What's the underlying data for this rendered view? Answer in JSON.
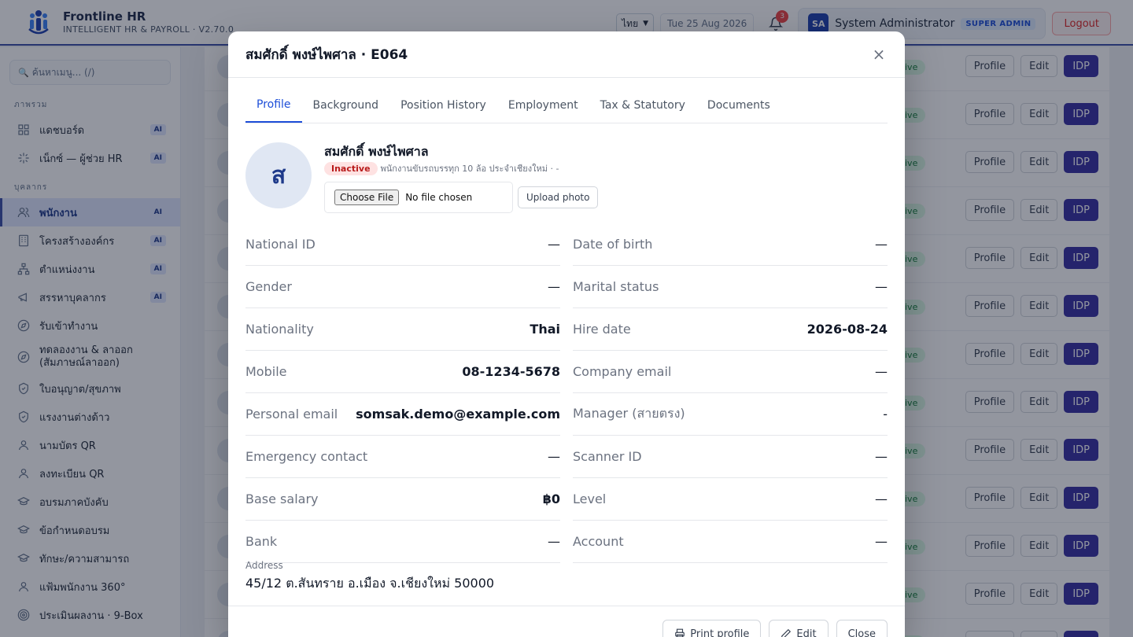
{
  "app": {
    "name": "Frontline HR",
    "subtitle": "INTELLIGENT HR & PAYROLL · V2.70.0",
    "language": "ไทย",
    "date": "Tue 25 Aug 2026",
    "notification_count": "3",
    "user_initials": "SA",
    "user_name": "System Administrator",
    "role": "SUPER ADMIN",
    "logout_label": "Logout",
    "accent_color": "#3b4fa8"
  },
  "sidebar": {
    "search_placeholder": "ค้นหาเมนู... (/)",
    "section_overview": "ภาพรวม",
    "overview_items": [
      {
        "label": "แดชบอร์ด",
        "badge": "AI",
        "icon": "grid-icon"
      },
      {
        "label": "เน็กซ์ — ผู้ช่วย HR",
        "badge": "AI",
        "icon": "sparkle-icon"
      }
    ],
    "section_people": "บุคลากร",
    "people_items": [
      {
        "label": "พนักงาน",
        "badge": "AI",
        "icon": "users-icon",
        "active": true
      },
      {
        "label": "โครงสร้างองค์กร",
        "badge": "AI",
        "icon": "building-icon"
      },
      {
        "label": "ตำแหน่งงาน",
        "badge": "AI",
        "icon": "org-chart-icon"
      },
      {
        "label": "สรรหาบุคลากร",
        "badge": "AI",
        "icon": "megaphone-icon"
      },
      {
        "label": "รับเข้าทำงาน",
        "badge": "",
        "icon": "compass-icon"
      },
      {
        "label": "ทดลองงาน & ลาออก (สัมภาษณ์ลาออก)",
        "badge": "",
        "icon": "compass-icon"
      },
      {
        "label": "ใบอนุญาต/สุขภาพ",
        "badge": "",
        "icon": "shield-check-icon"
      },
      {
        "label": "แรงงานต่างด้าว",
        "badge": "",
        "icon": "shield-check-icon"
      },
      {
        "label": "นามบัตร QR",
        "badge": "",
        "icon": "user-icon"
      },
      {
        "label": "ลงทะเบียน QR",
        "badge": "",
        "icon": "user-icon"
      },
      {
        "label": "อบรมภาคบังคับ",
        "badge": "",
        "icon": "graduation-cap-icon"
      },
      {
        "label": "ข้อกำหนดอบรม",
        "badge": "",
        "icon": "graduation-cap-icon"
      },
      {
        "label": "ทักษะ/ความสามารถ",
        "badge": "",
        "icon": "graduation-cap-icon"
      },
      {
        "label": "แฟ้มพนักงาน 360°",
        "badge": "",
        "icon": "user-icon"
      },
      {
        "label": "ประเมินผลงาน · 9-Box",
        "badge": "",
        "icon": "target-icon"
      }
    ]
  },
  "background_list": {
    "row_actions": {
      "profile": "Profile",
      "edit": "Edit",
      "idp": "IDP"
    },
    "status_fragment": "ive"
  },
  "modal": {
    "title": "สมศักดิ์ พงษ์ไพศาล · E064",
    "tabs": [
      "Profile",
      "Background",
      "Position History",
      "Employment",
      "Tax & Statutory",
      "Documents"
    ],
    "active_tab": "Profile",
    "avatar_initial": "ส",
    "name": "สมศักดิ์ พงษ์ไพศาล",
    "status": "Inactive",
    "position": "พนักงานขับรถบรรทุก 10 ล้อ ประจำเชียงใหม่ · -",
    "choose_file": "Choose File",
    "no_file": "No file chosen",
    "upload_photo": "Upload photo",
    "fields": [
      [
        {
          "label": "National ID",
          "value": "—"
        },
        {
          "label": "Date of birth",
          "value": "—"
        }
      ],
      [
        {
          "label": "Gender",
          "value": "—"
        },
        {
          "label": "Marital status",
          "value": "—"
        }
      ],
      [
        {
          "label": "Nationality",
          "value": "Thai"
        },
        {
          "label": "Hire date",
          "value": "2026-08-24"
        }
      ],
      [
        {
          "label": "Mobile",
          "value": "08-1234-5678"
        },
        {
          "label": "Company email",
          "value": "—"
        }
      ],
      [
        {
          "label": "Personal email",
          "value": "somsak.demo@example.com"
        },
        {
          "label": "Manager (สายตรง)",
          "value": "-"
        }
      ],
      [
        {
          "label": "Emergency contact",
          "value": "—"
        },
        {
          "label": "Scanner ID",
          "value": "—"
        }
      ],
      [
        {
          "label": "Base salary",
          "value": "฿0"
        },
        {
          "label": "Level",
          "value": "—"
        }
      ],
      [
        {
          "label": "Bank",
          "value": "—"
        },
        {
          "label": "Account",
          "value": "—"
        }
      ]
    ],
    "address_label": "Address",
    "address_value": "45/12 ต.สันทราย อ.เมือง จ.เชียงใหม่ 50000",
    "footer": {
      "print": "Print profile",
      "edit": "Edit",
      "close": "Close"
    }
  }
}
